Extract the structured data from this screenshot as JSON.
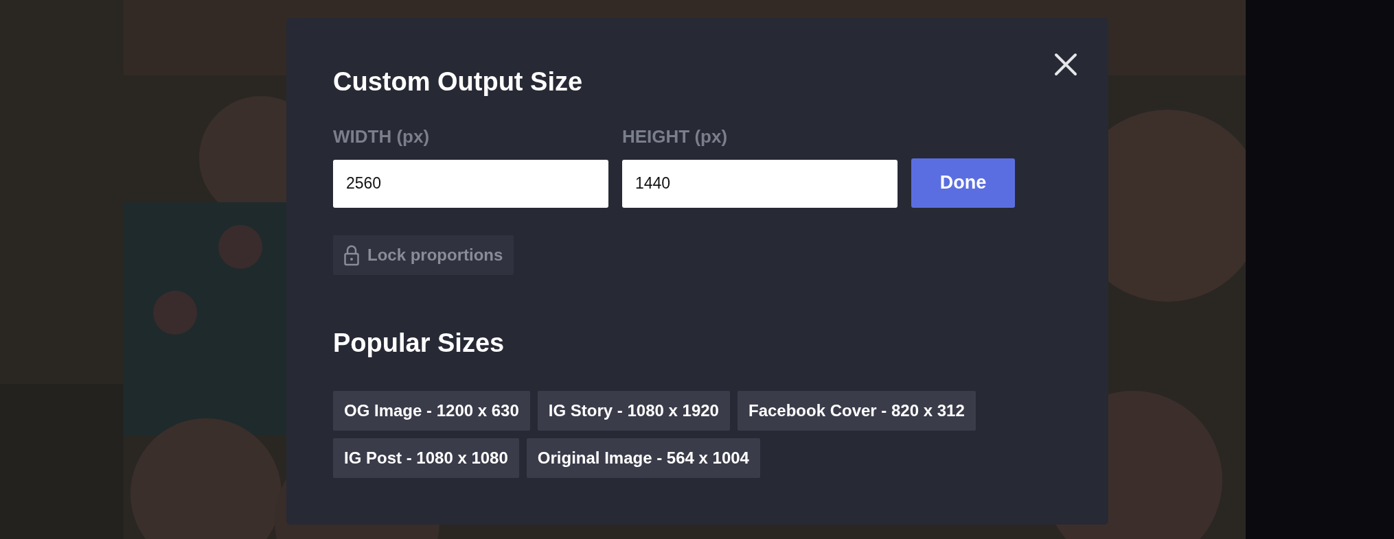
{
  "dialog": {
    "title": "Custom Output Size",
    "fields": [
      {
        "label": "WIDTH (px)",
        "value": "2560"
      },
      {
        "label": "HEIGHT (px)",
        "value": "1440"
      }
    ],
    "done_button": "Done",
    "lock_button": "Lock proportions",
    "popular_heading": "Popular Sizes",
    "popular_sizes": [
      "OG Image - 1200 x 630",
      "IG Story - 1080 x 1920",
      "Facebook Cover - 820 x 312",
      "IG Post - 1080 x 1080",
      "Original Image - 564 x 1004"
    ]
  }
}
